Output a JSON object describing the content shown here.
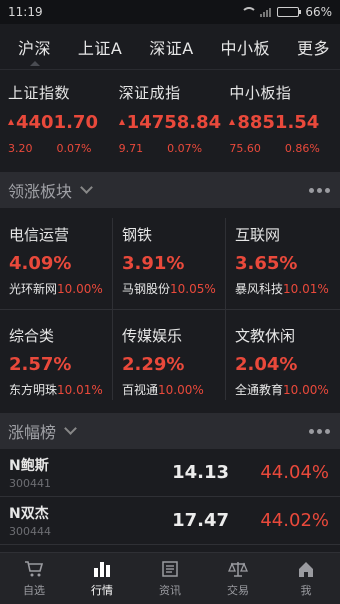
{
  "status": {
    "time": "11:19",
    "battery": "66%",
    "battery_level": 0.66
  },
  "tabs": [
    {
      "label": "沪深",
      "active": true
    },
    {
      "label": "上证A",
      "active": false
    },
    {
      "label": "深证A",
      "active": false
    },
    {
      "label": "中小板",
      "active": false
    },
    {
      "label": "更多",
      "active": false
    }
  ],
  "indices": [
    {
      "name": "上证指数",
      "value": "4401.70",
      "change": "3.20",
      "pct": "0.07%"
    },
    {
      "name": "深证成指",
      "value": "14758.84",
      "change": "9.71",
      "pct": "0.07%"
    },
    {
      "name": "中小板指",
      "value": "8851.54",
      "change": "75.60",
      "pct": "0.86%"
    }
  ],
  "sections": {
    "sectors_title": "领涨板块",
    "gainers_title": "涨幅榜"
  },
  "sectors": [
    {
      "name": "电信运营",
      "pct": "4.09%",
      "leader": "光环新网",
      "leader_pct": "10.00%"
    },
    {
      "name": "钢铁",
      "pct": "3.91%",
      "leader": "马钢股份",
      "leader_pct": "10.05%"
    },
    {
      "name": "互联网",
      "pct": "3.65%",
      "leader": "暴风科技",
      "leader_pct": "10.01%"
    },
    {
      "name": "综合类",
      "pct": "2.57%",
      "leader": "东方明珠",
      "leader_pct": "10.01%"
    },
    {
      "name": "传媒娱乐",
      "pct": "2.29%",
      "leader": "百视通",
      "leader_pct": "10.00%"
    },
    {
      "name": "文教休闲",
      "pct": "2.04%",
      "leader": "全通教育",
      "leader_pct": "10.00%"
    }
  ],
  "stocks": [
    {
      "name": "N鲍斯",
      "code": "300441",
      "price": "14.13",
      "pct": "44.04%"
    },
    {
      "name": "N双杰",
      "code": "300444",
      "price": "17.47",
      "pct": "44.02%"
    }
  ],
  "nav": [
    {
      "label": "自选",
      "icon": "cart-icon",
      "active": false
    },
    {
      "label": "行情",
      "icon": "bar-chart-icon",
      "active": true
    },
    {
      "label": "资讯",
      "icon": "news-icon",
      "active": false
    },
    {
      "label": "交易",
      "icon": "scale-icon",
      "active": false
    },
    {
      "label": "我",
      "icon": "home-icon",
      "active": false
    }
  ],
  "colors": {
    "up": "#e9493b",
    "background": "#1b1c20",
    "section": "#2b2c31"
  }
}
